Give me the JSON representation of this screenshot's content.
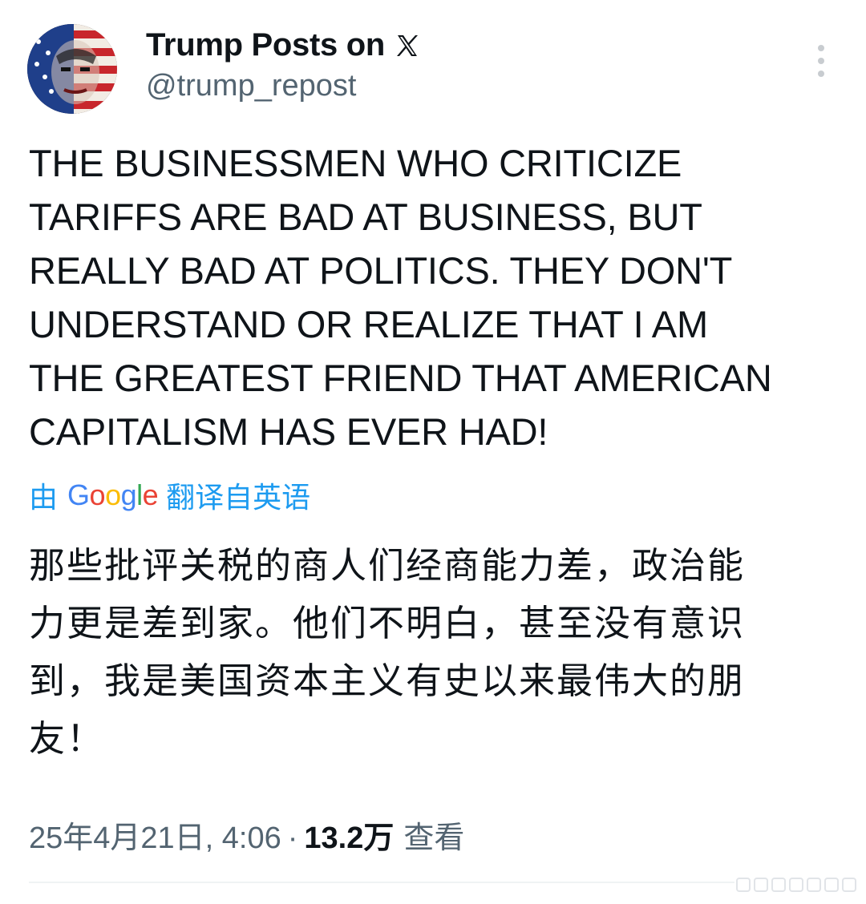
{
  "author": {
    "display_name": "Trump Posts on",
    "platform_icon": "x-logo-icon",
    "handle": "@trump_repost",
    "avatar_icon": "american-flag-portrait-avatar"
  },
  "post": {
    "text_en_lines": [
      "THE BUSINESSMEN WHO CRITICIZE",
      "TARIFFS ARE BAD AT BUSINESS, BUT",
      "REALLY BAD AT POLITICS. THEY DON'T",
      "UNDERSTAND OR REALIZE THAT I AM",
      "THE GREATEST FRIEND THAT AMERICAN",
      "CAPITALISM HAS EVER HAD!"
    ],
    "translation": {
      "prefix": "由",
      "provider": "Google",
      "suffix": "翻译自英语"
    },
    "text_zh_lines": [
      "那些批评关税的商人们经商能力差，政治能",
      "力更是差到家。他们不明白，甚至没有意识",
      "到，我是美国资本主义有史以来最伟大的朋",
      "友！"
    ]
  },
  "meta": {
    "timestamp": "25年4月21日, 4:06",
    "separator": "·",
    "views_count": "13.2万",
    "views_label": "查看"
  },
  "colors": {
    "text": "#0f1419",
    "secondary": "#536471",
    "link": "#1d9bf0"
  }
}
